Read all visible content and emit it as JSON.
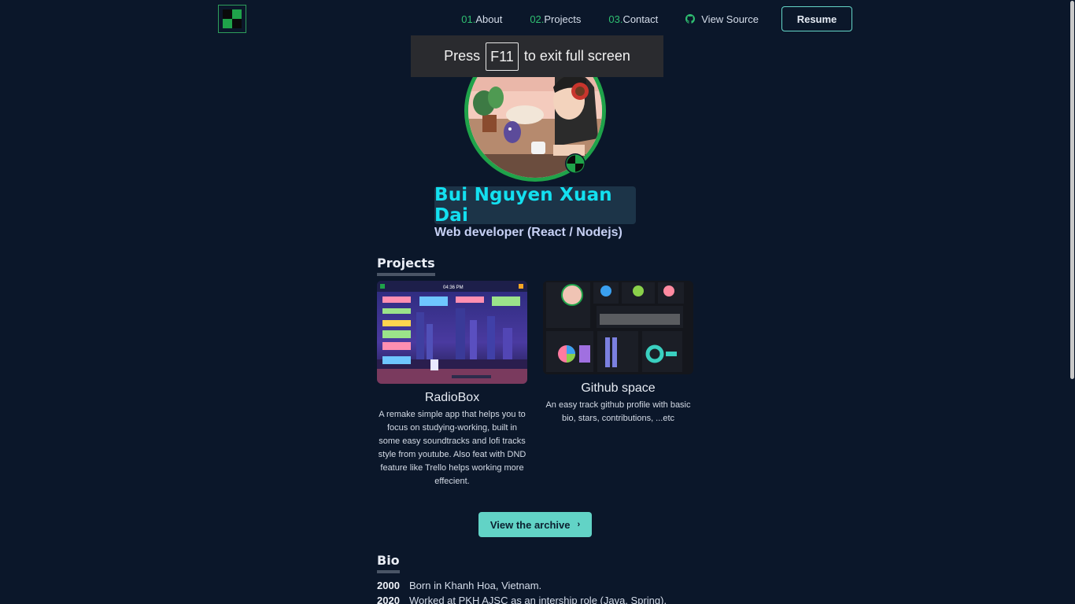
{
  "nav": {
    "links": [
      {
        "num": "01.",
        "label": "About"
      },
      {
        "num": "02.",
        "label": "Projects"
      },
      {
        "num": "03.",
        "label": "Contact"
      }
    ],
    "source_label": "View Source",
    "resume_label": "Resume"
  },
  "fullscreen_toast": {
    "before": "Press",
    "key": "F11",
    "after": "to exit full screen"
  },
  "profile": {
    "name": "Bui Nguyen Xuan Dai",
    "role": "Web developer (React / Nodejs)"
  },
  "projects": {
    "title": "Projects",
    "items": [
      {
        "title": "RadioBox",
        "description": "A remake simple app that helps you to focus on studying-working, built in some easy soundtracks and lofi tracks style from youtube. Also feat with DND feature like Trello helps working more effecient.",
        "thumb_clock": "04:36 PM"
      },
      {
        "title": "Github space",
        "description": "An easy track github profile with basic bio, stars, contributions, ...etc"
      }
    ],
    "archive_label": "View the archive"
  },
  "bio": {
    "title": "Bio",
    "entries": [
      {
        "year": "2000",
        "text": "Born in Khanh Hoa, Vietnam."
      },
      {
        "year": "2020",
        "text": "Worked at PKH AJSC as an intership role (Java, Spring)."
      }
    ]
  },
  "colors": {
    "background": "#0b172a",
    "accent_green": "#2fbf71",
    "name_cyan": "#13e0f0",
    "button_teal": "#62d3c6"
  }
}
